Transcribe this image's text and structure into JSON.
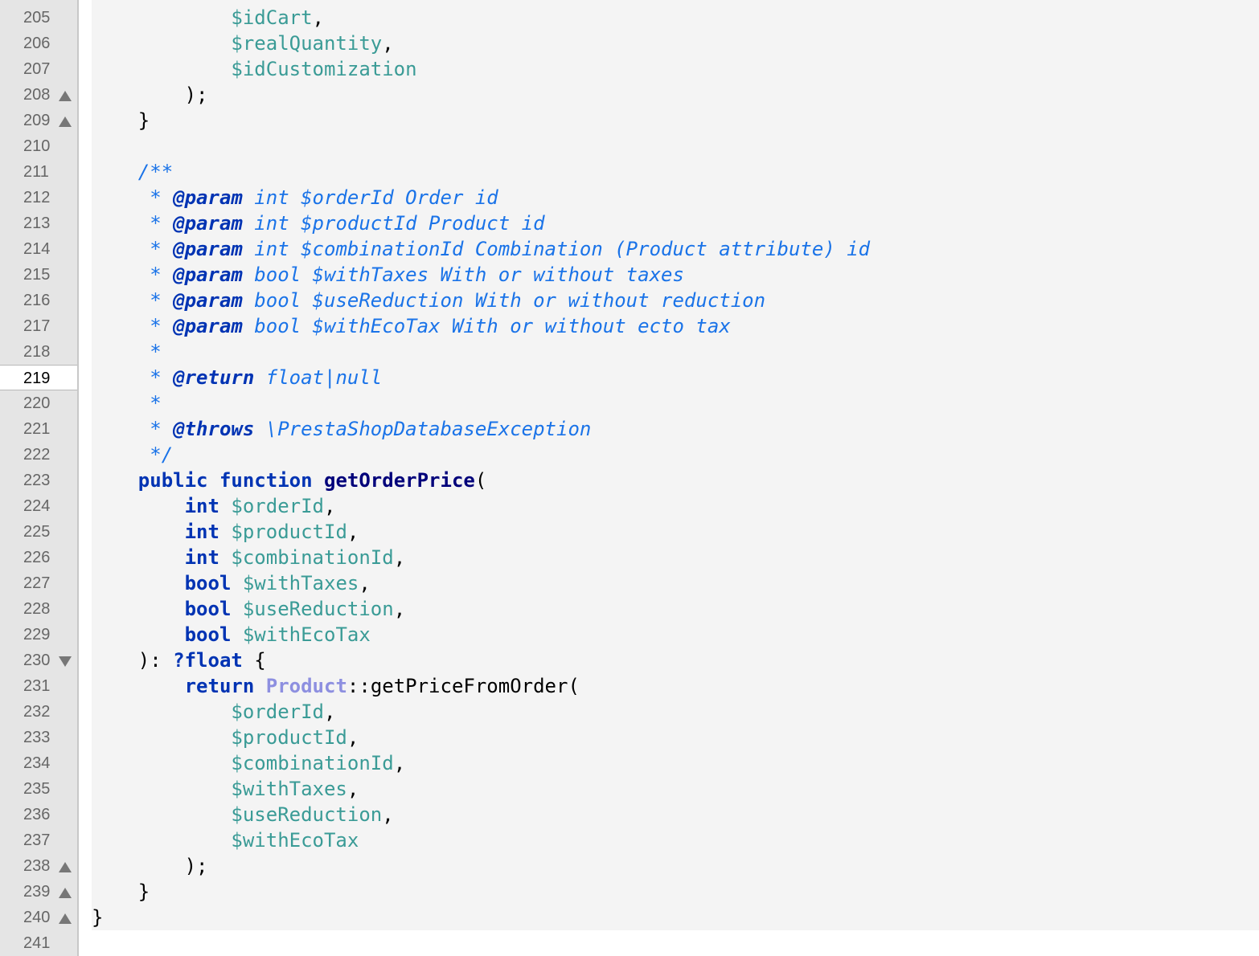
{
  "editor": {
    "colors": {
      "gutter_background": "#e5e5e5",
      "code_background": "#f4f4f4",
      "keyword": "#0033b3",
      "variable": "#3a9b96",
      "doc_comment": "#1a73e8",
      "class_reference": "#8d8fe0"
    },
    "lines": [
      {
        "number": "205",
        "fold": "",
        "tokens": [
          {
            "text": "            ",
            "kind": "plain"
          },
          {
            "text": "$idCart",
            "kind": "var"
          },
          {
            "text": ",",
            "kind": "plain"
          }
        ]
      },
      {
        "number": "206",
        "fold": "",
        "tokens": [
          {
            "text": "            ",
            "kind": "plain"
          },
          {
            "text": "$realQuantity",
            "kind": "var"
          },
          {
            "text": ",",
            "kind": "plain"
          }
        ]
      },
      {
        "number": "207",
        "fold": "",
        "tokens": [
          {
            "text": "            ",
            "kind": "plain"
          },
          {
            "text": "$idCustomization",
            "kind": "var"
          }
        ]
      },
      {
        "number": "208",
        "fold": "up",
        "tokens": [
          {
            "text": "        );",
            "kind": "plain"
          }
        ]
      },
      {
        "number": "209",
        "fold": "up",
        "tokens": [
          {
            "text": "    }",
            "kind": "plain"
          }
        ]
      },
      {
        "number": "210",
        "fold": "",
        "tokens": []
      },
      {
        "number": "211",
        "fold": "",
        "tokens": [
          {
            "text": "    /**",
            "kind": "doc"
          }
        ]
      },
      {
        "number": "212",
        "fold": "",
        "tokens": [
          {
            "text": "     * ",
            "kind": "doc"
          },
          {
            "text": "@param",
            "kind": "doc-tag"
          },
          {
            "text": " int $orderId Order id",
            "kind": "doc"
          }
        ]
      },
      {
        "number": "213",
        "fold": "",
        "tokens": [
          {
            "text": "     * ",
            "kind": "doc"
          },
          {
            "text": "@param",
            "kind": "doc-tag"
          },
          {
            "text": " int $productId Product id",
            "kind": "doc"
          }
        ]
      },
      {
        "number": "214",
        "fold": "",
        "tokens": [
          {
            "text": "     * ",
            "kind": "doc"
          },
          {
            "text": "@param",
            "kind": "doc-tag"
          },
          {
            "text": " int $combinationId Combination (Product attribute) id",
            "kind": "doc"
          }
        ]
      },
      {
        "number": "215",
        "fold": "",
        "tokens": [
          {
            "text": "     * ",
            "kind": "doc"
          },
          {
            "text": "@param",
            "kind": "doc-tag"
          },
          {
            "text": " bool $withTaxes With or without taxes",
            "kind": "doc"
          }
        ]
      },
      {
        "number": "216",
        "fold": "",
        "tokens": [
          {
            "text": "     * ",
            "kind": "doc"
          },
          {
            "text": "@param",
            "kind": "doc-tag"
          },
          {
            "text": " bool $useReduction With or without reduction",
            "kind": "doc"
          }
        ]
      },
      {
        "number": "217",
        "fold": "",
        "tokens": [
          {
            "text": "     * ",
            "kind": "doc"
          },
          {
            "text": "@param",
            "kind": "doc-tag"
          },
          {
            "text": " bool $withEcoTax With or without ecto tax",
            "kind": "doc"
          }
        ]
      },
      {
        "number": "218",
        "fold": "",
        "tokens": [
          {
            "text": "     *",
            "kind": "doc"
          }
        ]
      },
      {
        "number": "219",
        "fold": "",
        "current": true,
        "tokens": [
          {
            "text": "     * ",
            "kind": "doc"
          },
          {
            "text": "@return",
            "kind": "doc-tag"
          },
          {
            "text": " float|null",
            "kind": "doc"
          }
        ]
      },
      {
        "number": "220",
        "fold": "",
        "tokens": [
          {
            "text": "     *",
            "kind": "doc"
          }
        ]
      },
      {
        "number": "221",
        "fold": "",
        "tokens": [
          {
            "text": "     * ",
            "kind": "doc"
          },
          {
            "text": "@throws",
            "kind": "doc-tag"
          },
          {
            "text": " \\PrestaShopDatabaseException",
            "kind": "doc"
          }
        ]
      },
      {
        "number": "222",
        "fold": "",
        "tokens": [
          {
            "text": "     */",
            "kind": "doc"
          }
        ]
      },
      {
        "number": "223",
        "fold": "",
        "tokens": [
          {
            "text": "    ",
            "kind": "plain"
          },
          {
            "text": "public",
            "kind": "kw"
          },
          {
            "text": " ",
            "kind": "plain"
          },
          {
            "text": "function",
            "kind": "kw"
          },
          {
            "text": " ",
            "kind": "plain"
          },
          {
            "text": "getOrderPrice",
            "kind": "fn"
          },
          {
            "text": "(",
            "kind": "plain"
          }
        ]
      },
      {
        "number": "224",
        "fold": "",
        "tokens": [
          {
            "text": "        ",
            "kind": "plain"
          },
          {
            "text": "int",
            "kind": "kw"
          },
          {
            "text": " ",
            "kind": "plain"
          },
          {
            "text": "$orderId",
            "kind": "var"
          },
          {
            "text": ",",
            "kind": "plain"
          }
        ]
      },
      {
        "number": "225",
        "fold": "",
        "tokens": [
          {
            "text": "        ",
            "kind": "plain"
          },
          {
            "text": "int",
            "kind": "kw"
          },
          {
            "text": " ",
            "kind": "plain"
          },
          {
            "text": "$productId",
            "kind": "var"
          },
          {
            "text": ",",
            "kind": "plain"
          }
        ]
      },
      {
        "number": "226",
        "fold": "",
        "tokens": [
          {
            "text": "        ",
            "kind": "plain"
          },
          {
            "text": "int",
            "kind": "kw"
          },
          {
            "text": " ",
            "kind": "plain"
          },
          {
            "text": "$combinationId",
            "kind": "var"
          },
          {
            "text": ",",
            "kind": "plain"
          }
        ]
      },
      {
        "number": "227",
        "fold": "",
        "tokens": [
          {
            "text": "        ",
            "kind": "plain"
          },
          {
            "text": "bool",
            "kind": "kw"
          },
          {
            "text": " ",
            "kind": "plain"
          },
          {
            "text": "$withTaxes",
            "kind": "var"
          },
          {
            "text": ",",
            "kind": "plain"
          }
        ]
      },
      {
        "number": "228",
        "fold": "",
        "tokens": [
          {
            "text": "        ",
            "kind": "plain"
          },
          {
            "text": "bool",
            "kind": "kw"
          },
          {
            "text": " ",
            "kind": "plain"
          },
          {
            "text": "$useReduction",
            "kind": "var"
          },
          {
            "text": ",",
            "kind": "plain"
          }
        ]
      },
      {
        "number": "229",
        "fold": "",
        "tokens": [
          {
            "text": "        ",
            "kind": "plain"
          },
          {
            "text": "bool",
            "kind": "kw"
          },
          {
            "text": " ",
            "kind": "plain"
          },
          {
            "text": "$withEcoTax",
            "kind": "var"
          }
        ]
      },
      {
        "number": "230",
        "fold": "down",
        "tokens": [
          {
            "text": "    ): ",
            "kind": "plain"
          },
          {
            "text": "?float",
            "kind": "kw"
          },
          {
            "text": " {",
            "kind": "plain"
          }
        ]
      },
      {
        "number": "231",
        "fold": "",
        "tokens": [
          {
            "text": "        ",
            "kind": "plain"
          },
          {
            "text": "return",
            "kind": "kw"
          },
          {
            "text": " ",
            "kind": "plain"
          },
          {
            "text": "Product",
            "kind": "cls"
          },
          {
            "text": "::",
            "kind": "plain"
          },
          {
            "text": "getPriceFromOrder(",
            "kind": "plain"
          }
        ]
      },
      {
        "number": "232",
        "fold": "",
        "tokens": [
          {
            "text": "            ",
            "kind": "plain"
          },
          {
            "text": "$orderId",
            "kind": "var"
          },
          {
            "text": ",",
            "kind": "plain"
          }
        ]
      },
      {
        "number": "233",
        "fold": "",
        "tokens": [
          {
            "text": "            ",
            "kind": "plain"
          },
          {
            "text": "$productId",
            "kind": "var"
          },
          {
            "text": ",",
            "kind": "plain"
          }
        ]
      },
      {
        "number": "234",
        "fold": "",
        "tokens": [
          {
            "text": "            ",
            "kind": "plain"
          },
          {
            "text": "$combinationId",
            "kind": "var"
          },
          {
            "text": ",",
            "kind": "plain"
          }
        ]
      },
      {
        "number": "235",
        "fold": "",
        "tokens": [
          {
            "text": "            ",
            "kind": "plain"
          },
          {
            "text": "$withTaxes",
            "kind": "var"
          },
          {
            "text": ",",
            "kind": "plain"
          }
        ]
      },
      {
        "number": "236",
        "fold": "",
        "tokens": [
          {
            "text": "            ",
            "kind": "plain"
          },
          {
            "text": "$useReduction",
            "kind": "var"
          },
          {
            "text": ",",
            "kind": "plain"
          }
        ]
      },
      {
        "number": "237",
        "fold": "",
        "tokens": [
          {
            "text": "            ",
            "kind": "plain"
          },
          {
            "text": "$withEcoTax",
            "kind": "var"
          }
        ]
      },
      {
        "number": "238",
        "fold": "up",
        "tokens": [
          {
            "text": "        );",
            "kind": "plain"
          }
        ]
      },
      {
        "number": "239",
        "fold": "up",
        "tokens": [
          {
            "text": "    }",
            "kind": "plain"
          }
        ]
      },
      {
        "number": "240",
        "fold": "up",
        "tokens": [
          {
            "text": "}",
            "kind": "plain"
          }
        ]
      },
      {
        "number": "241",
        "fold": "",
        "tokens": []
      }
    ]
  }
}
